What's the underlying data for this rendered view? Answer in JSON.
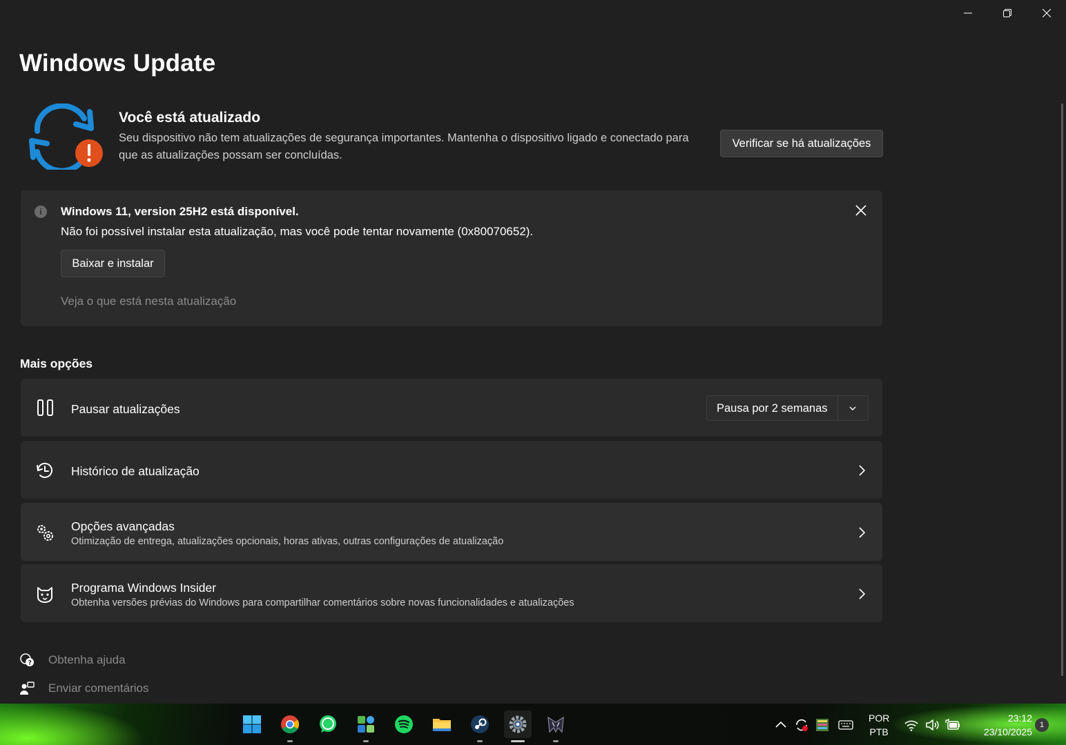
{
  "window": {
    "title": "Windows Update"
  },
  "status": {
    "title": "Você está atualizado",
    "description": "Seu dispositivo não tem atualizações de segurança importantes. Mantenha o dispositivo ligado e conectado para que as atualizações possam ser concluídas.",
    "check_button": "Verificar se há atualizações",
    "icon": "sync-warning-icon",
    "accent_color": "#1d8ad8",
    "warning_color": "#e0501c"
  },
  "info_bar": {
    "title": "Windows 11, version 25H2 está disponível.",
    "message": "Não foi possível instalar esta atualização, mas você pode tentar novamente (0x80070652).",
    "install_button": "Baixar e instalar",
    "link": "Veja o que está nesta atualização"
  },
  "more_options": {
    "title": "Mais opções",
    "pause": {
      "label": "Pausar atualizações",
      "selected": "Pausa por 2 semanas",
      "icon": "pause-icon"
    },
    "items": [
      {
        "label": "Histórico de atualização",
        "subtitle": "",
        "icon": "history-icon"
      },
      {
        "label": "Opções avançadas",
        "subtitle": "Otimização de entrega, atualizações opcionais, horas ativas, outras configurações de atualização",
        "icon": "gears-icon"
      },
      {
        "label": "Programa Windows Insider",
        "subtitle": "Obtenha versões prévias do Windows para compartilhar comentários sobre novas funcionalidades e atualizações",
        "icon": "insider-cat-icon"
      }
    ]
  },
  "footer": {
    "help": "Obtenha ajuda",
    "feedback": "Enviar comentários"
  },
  "taskbar": {
    "apps": [
      "start-icon",
      "chrome-icon",
      "whatsapp-icon",
      "widgets-icon",
      "spotify-icon",
      "file-explorer-icon",
      "steam-icon",
      "settings-icon",
      "predator-icon"
    ],
    "language_line1": "POR",
    "language_line2": "PTB",
    "time": "23:12",
    "date": "23/10/2025",
    "notification_count": "1"
  }
}
